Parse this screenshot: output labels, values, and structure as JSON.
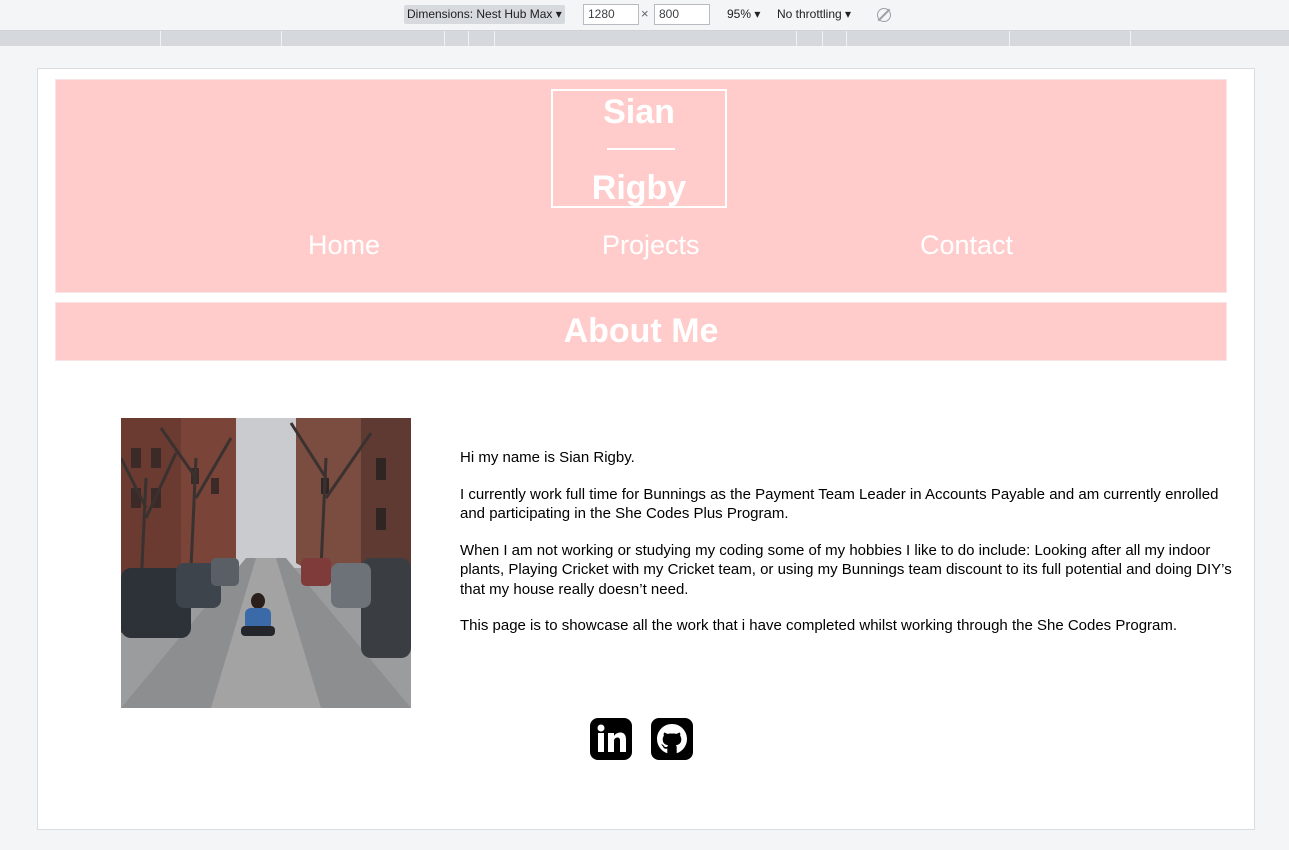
{
  "devtools": {
    "dimensions_label": "Dimensions: Nest Hub Max",
    "width_value": "1280",
    "height_value": "800",
    "times": "×",
    "zoom": "95%",
    "throttling": "No throttling",
    "rotate_icon": "rotate-icon"
  },
  "site": {
    "logo": {
      "first": "Sian",
      "last": "Rigby"
    },
    "nav": {
      "home": "Home",
      "projects": "Projects",
      "contact": "Contact"
    },
    "section_title": "About Me",
    "bio": {
      "p1": "Hi my name is Sian Rigby.",
      "p2": "I currently work full time for Bunnings as the Payment Team Leader in Accounts Payable and am currently enrolled and participating in the She Codes Plus Program.",
      "p3": "When I am not working or studying my coding some of my hobbies I like to do include: Looking after all my indoor plants, Playing Cricket with my Cricket team, or using my Bunnings team discount to its full potential and doing DIY’s that my house really doesn’t need.",
      "p4": "This page is to showcase all the work that i have completed whilst working through the She Codes Program."
    },
    "social": {
      "linkedin_icon": "linkedin-icon",
      "github_icon": "github-icon"
    },
    "colors": {
      "accent": "#ffcccb",
      "text": "#000000",
      "header_text": "#ffffff"
    }
  }
}
